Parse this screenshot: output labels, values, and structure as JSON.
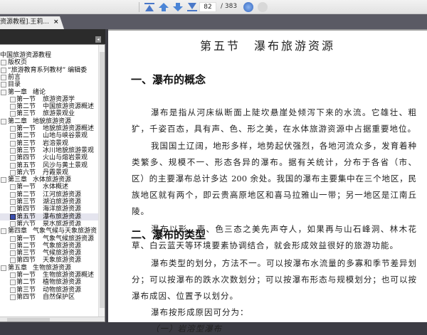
{
  "toolbar": {
    "current_page": "82",
    "total_pages": "/ 383"
  },
  "tab": {
    "title": "资源教程].王莉...",
    "close": "×"
  },
  "sidebar": {
    "collapse": "◂",
    "items": [
      {
        "num": "",
        "title": "中国旅游资源教程",
        "level": 0
      },
      {
        "num": "",
        "title": "版权页",
        "level": 1
      },
      {
        "num": "",
        "title": "“旅游教育系列教材” 编辑委",
        "level": 1
      },
      {
        "num": "",
        "title": "前言",
        "level": 1
      },
      {
        "num": "",
        "title": "目录",
        "level": 1
      },
      {
        "num": "第一章",
        "title": "绪论",
        "level": 1
      },
      {
        "num": "第一节",
        "title": "旅游资源学",
        "level": 2
      },
      {
        "num": "第二节",
        "title": "中国旅游资源概述",
        "level": 2
      },
      {
        "num": "第三节",
        "title": "旅游景观业",
        "level": 2
      },
      {
        "num": "第二章",
        "title": "地貌旅游资源",
        "level": 1
      },
      {
        "num": "第一节",
        "title": "地貌旅游资源概述",
        "level": 2
      },
      {
        "num": "第二节",
        "title": "山地与峡谷景观",
        "level": 2
      },
      {
        "num": "第三节",
        "title": "岩溶景观",
        "level": 2
      },
      {
        "num": "第三节",
        "title": "冰川地貌旅游景观",
        "level": 2
      },
      {
        "num": "第四节",
        "title": "火山与熔岩景观",
        "level": 2
      },
      {
        "num": "第五节",
        "title": "风沙与黄土景观",
        "level": 2
      },
      {
        "num": "第六节",
        "title": "丹霞景观",
        "level": 2
      },
      {
        "num": "第三章",
        "title": "水体旅游资源",
        "level": 1
      },
      {
        "num": "第一节",
        "title": "水体概述",
        "level": 2
      },
      {
        "num": "第二节",
        "title": "江河旅游资源",
        "level": 2
      },
      {
        "num": "第三节",
        "title": "湖泊旅游资源",
        "level": 2
      },
      {
        "num": "第四节",
        "title": "海洋旅游资源",
        "level": 2
      },
      {
        "num": "第五节",
        "title": "瀑布旅游资源",
        "level": 2,
        "selected": true
      },
      {
        "num": "第六节",
        "title": "泉水旅游资源",
        "level": 2
      },
      {
        "num": "第四章",
        "title": "气象气候与天象旅游资",
        "level": 1
      },
      {
        "num": "第一节",
        "title": "气象气候旅游资源",
        "level": 2
      },
      {
        "num": "第二节",
        "title": "气象旅游资源",
        "level": 2
      },
      {
        "num": "第三节",
        "title": "气候旅游资源",
        "level": 2
      },
      {
        "num": "第四节",
        "title": "天象旅游资源",
        "level": 2
      },
      {
        "num": "第五章",
        "title": "生物旅游资源",
        "level": 1
      },
      {
        "num": "第一节",
        "title": "生物旅游资源概述",
        "level": 2
      },
      {
        "num": "第二节",
        "title": "植物旅游资源",
        "level": 2
      },
      {
        "num": "第三节",
        "title": "动物旅游资源",
        "level": 2
      },
      {
        "num": "第四节",
        "title": "自然保护区",
        "level": 2
      }
    ]
  },
  "document": {
    "title": "第五节　瀑布旅游资源",
    "heading1": "一、瀑布的概念",
    "heading2": "二、瀑布的类型",
    "lines": [
      {
        "text": "瀑布是指从河床纵断面上陡坎悬崖处倾泻下来的水流。它雄壮、粗",
        "indent": true
      },
      {
        "text": "犷，千姿百态，具有声、色、形之美，在水体旅游资源中占据重要地位。",
        "last": true
      },
      {
        "text": "我国国土辽阔，地形多样，地势起伏强烈，各地河流众多，发育着种",
        "indent": true
      },
      {
        "text": "类繁多、规模不一、形态各异的瀑布。据有关统计，分布于各省（市、"
      },
      {
        "text": "区）的主要瀑布总计多达 200 余处。我国的瀑布主要集中在三个地区，民"
      },
      {
        "text": "族地区就有两个，即云贵高原地区和喜马拉雅山一带；另一地区是江南丘"
      },
      {
        "text": "陵。",
        "last": true
      },
      {
        "text": "瀑布以形、声、色三态之美先声夺人，如果再与山石峰洞、林木花",
        "indent": true
      },
      {
        "text": "草、白云蓝天等环境要素协调结合，就会形成效益很好的旅游功能。",
        "last": true
      },
      {
        "text": "瀑布类型的划分，方法不一。可以按瀑布水流量的多寡和季节差异划",
        "indent": true
      },
      {
        "text": "分；可以按瀑布的跌水次数划分；可以按瀑布形态与规模划分；也可以按"
      },
      {
        "text": "瀑布成因、位置予以划分。",
        "last": true
      },
      {
        "text": "瀑布按形成原因可分为：",
        "indent": true,
        "last": true
      },
      {
        "text": "（一）岩溶型瀑布",
        "indent": true,
        "last": true,
        "italic": true
      }
    ]
  }
}
